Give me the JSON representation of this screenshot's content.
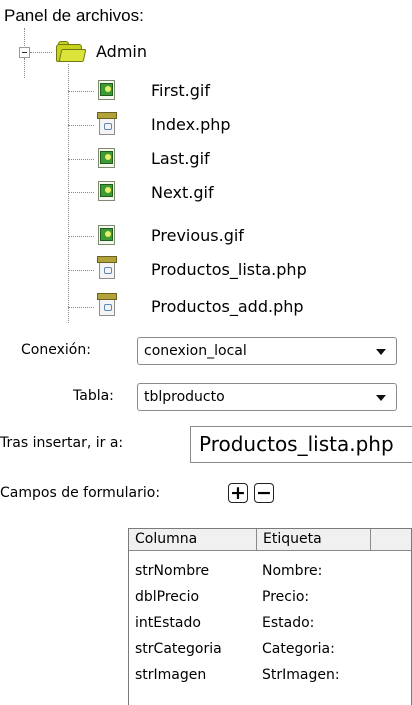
{
  "panel": {
    "title": "Panel de archivos:"
  },
  "tree": {
    "root": {
      "label": "Admin",
      "expanded": true,
      "icon": "folder-icon"
    },
    "files": [
      {
        "label": "First.gif",
        "type": "gif",
        "icon": "gif-file-icon"
      },
      {
        "label": "Index.php",
        "type": "php",
        "icon": "php-file-icon"
      },
      {
        "label": "Last.gif",
        "type": "gif",
        "icon": "gif-file-icon"
      },
      {
        "label": "Next.gif",
        "type": "gif",
        "icon": "gif-file-icon"
      },
      {
        "label": "Previous.gif",
        "type": "gif",
        "icon": "gif-file-icon"
      },
      {
        "label": "Productos_lista.php",
        "type": "php",
        "icon": "php-file-icon"
      },
      {
        "label": "Productos_add.php",
        "type": "php",
        "icon": "php-file-icon"
      }
    ]
  },
  "form": {
    "connection": {
      "label": "Conexión:",
      "value": "conexion_local"
    },
    "table": {
      "label": "Tabla:",
      "value": "tblproducto"
    },
    "after_insert": {
      "label": "Tras insertar, ir a:",
      "value": "Productos_lista.php"
    },
    "fields": {
      "label": "Campos de formulario:",
      "add": "+",
      "remove": "−"
    }
  },
  "grid": {
    "columns": [
      "Columna",
      "Etiqueta"
    ],
    "rows": [
      [
        "strNombre",
        "Nombre:"
      ],
      [
        "dblPrecio",
        "Precio:"
      ],
      [
        "intEstado",
        "Estado:"
      ],
      [
        "strCategoria",
        "Categoria:"
      ],
      [
        "strImagen",
        "StrImagen:"
      ]
    ]
  },
  "colors": {
    "folder": "#c8d21c",
    "gif_icon": "#3d9a35",
    "php_icon": "#b1a23a",
    "border": "#8a8a8a"
  }
}
